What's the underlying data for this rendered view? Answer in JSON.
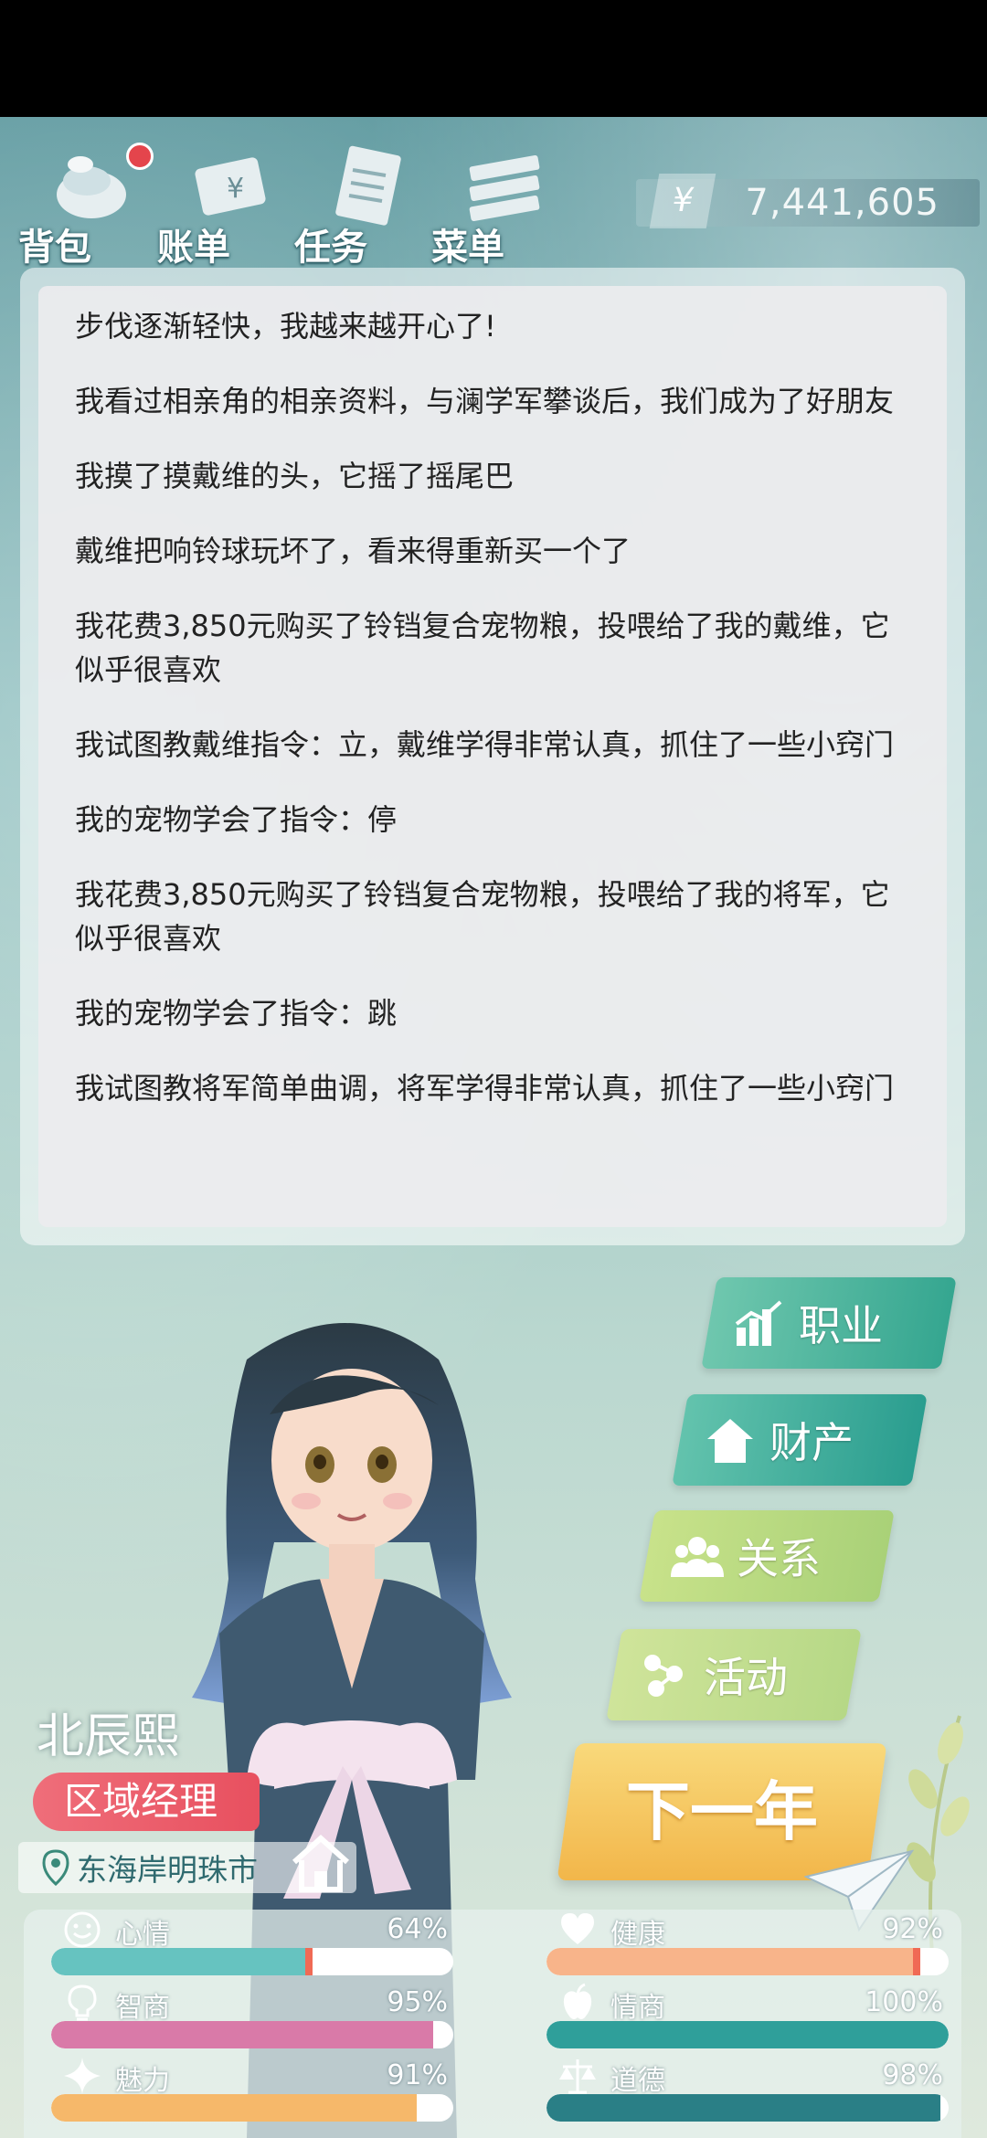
{
  "toolbar": {
    "items": [
      {
        "label": "背包",
        "icon": "backpack-icon",
        "badge": true
      },
      {
        "label": "账单",
        "icon": "bill-icon"
      },
      {
        "label": "任务",
        "icon": "task-icon"
      },
      {
        "label": "菜单",
        "icon": "menu-icon"
      }
    ]
  },
  "money": {
    "symbol": "¥",
    "value": "7,441,605"
  },
  "log": [
    "步伐逐渐轻快，我越来越开心了!",
    "我看过相亲角的相亲资料，与澜学军攀谈后，我们成为了好朋友",
    "我摸了摸戴维的头，它摇了摇尾巴",
    "戴维把响铃球玩坏了，看来得重新买一个了",
    "我花费3,850元购买了铃铛复合宠物粮，投喂给了我的戴维，它似乎很喜欢",
    "我试图教戴维指令：立，戴维学得非常认真，抓住了一些小窍门",
    "我的宠物学会了指令：停",
    "我花费3,850元购买了铃铛复合宠物粮，投喂给了我的将军，它似乎很喜欢",
    "我的宠物学会了指令：跳",
    "我试图教将军简单曲调，将军学得非常认真，抓住了一些小窍门"
  ],
  "side_menu": {
    "career": "职业",
    "property": "财产",
    "relation": "关系",
    "activity": "活动",
    "next_year": "下一年"
  },
  "character": {
    "name": "北辰熙",
    "title": "区域经理",
    "location": "东海岸明珠市"
  },
  "stats": [
    {
      "name": "心情",
      "value": "64%",
      "level": 64,
      "color": "#66c3c0",
      "icon": "smiley-icon"
    },
    {
      "name": "健康",
      "value": "92%",
      "level": 92,
      "color": "#f8b48a",
      "icon": "heart-icon"
    },
    {
      "name": "智商",
      "value": "95%",
      "level": 95,
      "color": "#d97aa8",
      "icon": "lightbulb-icon"
    },
    {
      "name": "情商",
      "value": "100%",
      "level": 100,
      "color": "#2f9f9a",
      "icon": "apple-icon"
    },
    {
      "name": "魅力",
      "value": "91%",
      "level": 91,
      "color": "#f6b86a",
      "icon": "sparkle-icon"
    },
    {
      "name": "道德",
      "value": "98%",
      "level": 98,
      "color": "#2a7f86",
      "icon": "scale-icon"
    }
  ],
  "colors": {
    "career_button": "#35a690",
    "next_year_button": "#f2b64a",
    "title_badge": "#e8505f"
  }
}
